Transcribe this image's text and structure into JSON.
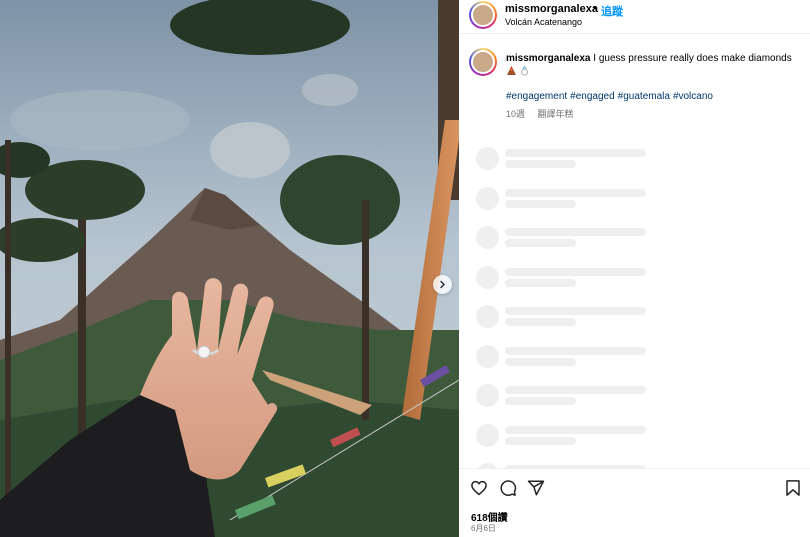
{
  "post": {
    "username": "missmorganalexa",
    "separator": "•",
    "follow_label": "追蹤",
    "location": "Volcán Acatenango"
  },
  "caption": {
    "username": "missmorganalexa",
    "text": "I guess pressure really does make diamonds ",
    "emojis": [
      "volcano-emoji",
      "ring-emoji"
    ],
    "hashtags": [
      "#engagement",
      "#engaged",
      "#guatemala",
      "#volcano"
    ],
    "age": "10週",
    "translate_label": "翻譯年糕"
  },
  "comments_loading_rows": 9,
  "footer": {
    "likes": "618個讚",
    "date": "6月6日"
  },
  "icons": [
    "heart-icon",
    "comment-icon",
    "share-icon",
    "bookmark-icon",
    "chevron-right-icon"
  ],
  "colors": {
    "link": "#0095f6",
    "hashtag": "#00376b",
    "muted": "#737373",
    "skeleton": "#efefef"
  }
}
